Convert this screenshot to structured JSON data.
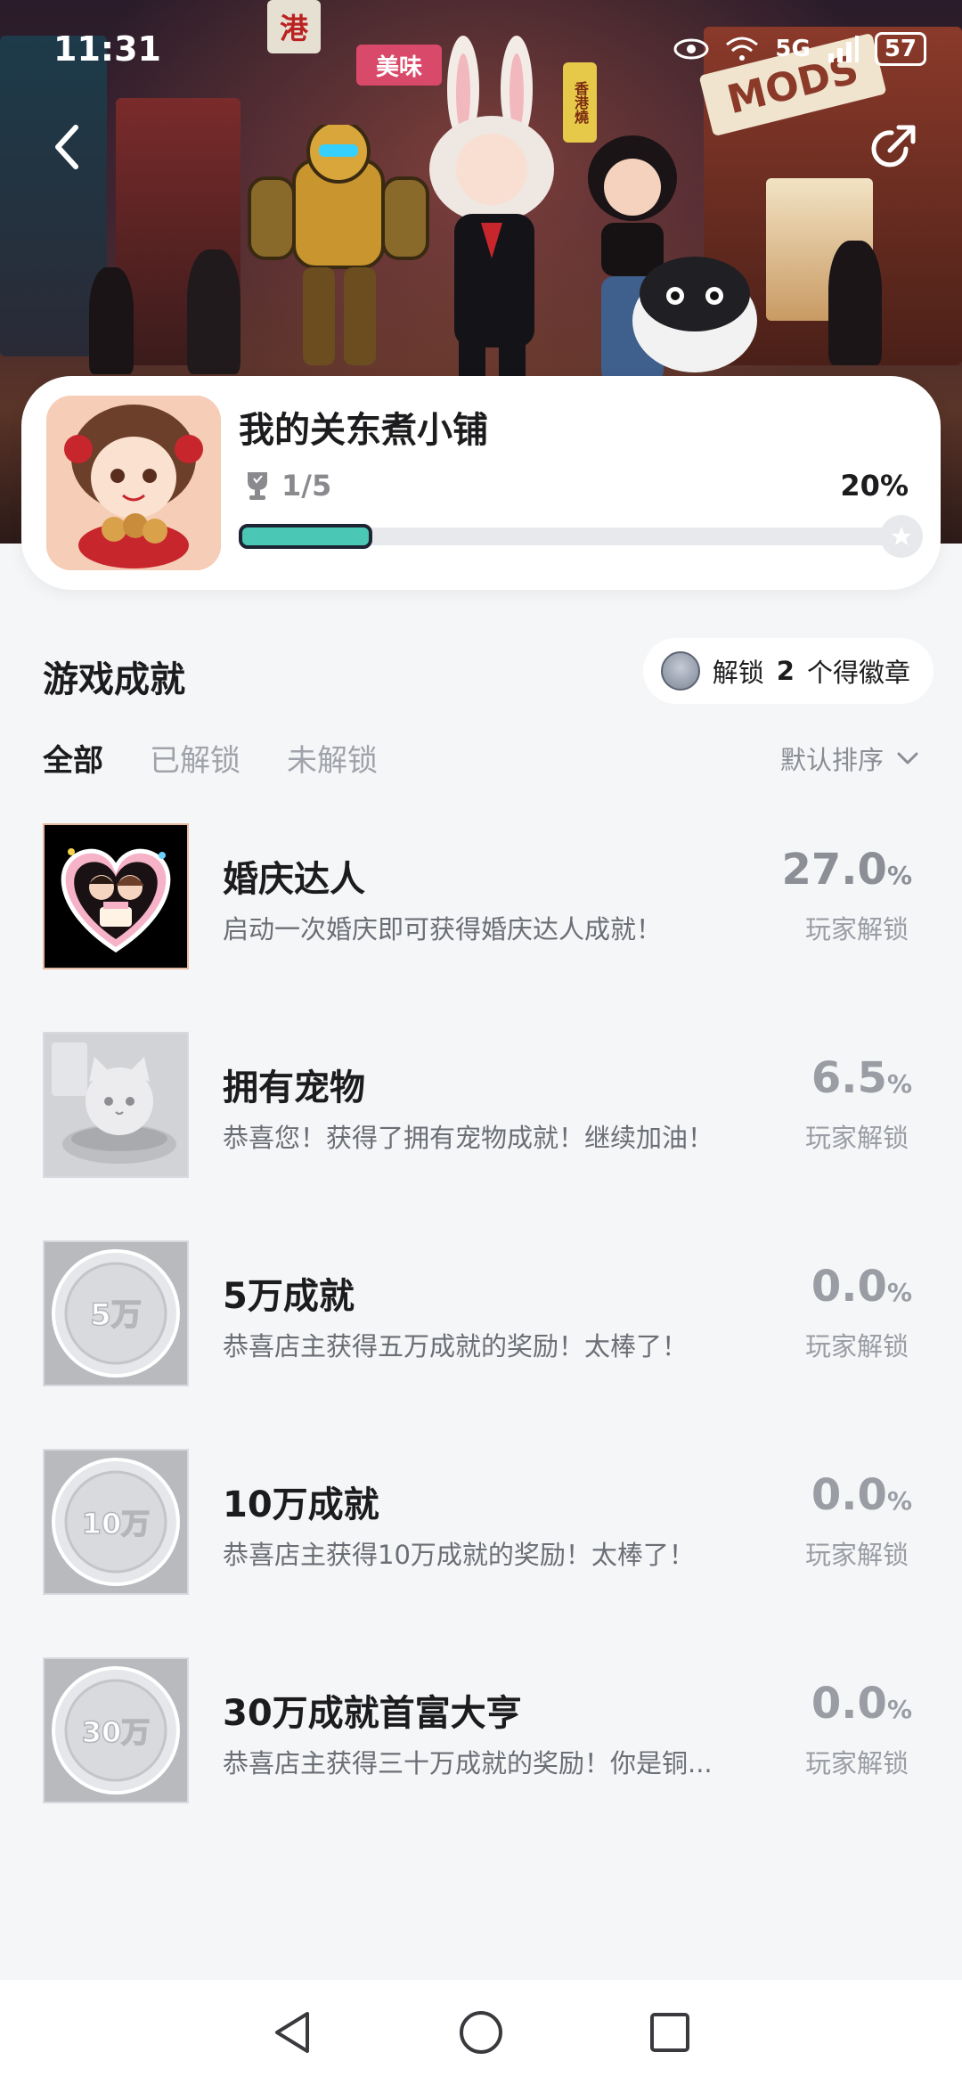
{
  "status": {
    "time": "11:31",
    "network": "5G",
    "battery": "57"
  },
  "header": {
    "back_icon": "chevron-left-icon",
    "share_icon": "share-icon",
    "banner_signs": [
      "港",
      "美味",
      "香港燒",
      "MODS"
    ]
  },
  "shop": {
    "title": "我的关东煮小铺",
    "trophy_icon": "trophy-icon",
    "progress_text": "1/5",
    "progress_percent_text": "20%",
    "progress_fraction": 0.2
  },
  "section": {
    "title": "游戏成就",
    "unlock_pill": {
      "prefix": "解锁",
      "count": "2",
      "suffix": "个得徽章"
    },
    "tabs": [
      {
        "label": "全部",
        "active": true
      },
      {
        "label": "已解锁",
        "active": false
      },
      {
        "label": "未解锁",
        "active": false
      }
    ],
    "sort_label": "默认排序"
  },
  "achievements": [
    {
      "title": "婚庆达人",
      "desc": "启动一次婚庆即可获得婚庆达人成就！",
      "percent": "27.0",
      "unit": "%",
      "sub": "玩家解锁",
      "unlocked": true,
      "icon": "wedding-couple-icon"
    },
    {
      "title": "拥有宠物",
      "desc": "恭喜您！获得了拥有宠物成就！继续加油！",
      "percent": "6.5",
      "unit": "%",
      "sub": "玩家解锁",
      "unlocked": false,
      "icon": "pet-cat-icon"
    },
    {
      "title": "5万成就",
      "desc": "恭喜店主获得五万成就的奖励！太棒了！",
      "percent": "0.0",
      "unit": "%",
      "sub": "玩家解锁",
      "unlocked": false,
      "icon": "coin-5w-icon",
      "coin_text": "5万"
    },
    {
      "title": "10万成就",
      "desc": "恭喜店主获得10万成就的奖励！太棒了！",
      "percent": "0.0",
      "unit": "%",
      "sub": "玩家解锁",
      "unlocked": false,
      "icon": "coin-10w-icon",
      "coin_text": "10万"
    },
    {
      "title": "30万成就首富大亨",
      "desc": "恭喜店主获得三十万成就的奖励！你是铜...",
      "percent": "0.0",
      "unit": "%",
      "sub": "玩家解锁",
      "unlocked": false,
      "icon": "coin-30w-icon",
      "coin_text": "30万"
    }
  ],
  "sysnav": {
    "back": "nav-back-icon",
    "home": "nav-home-icon",
    "recents": "nav-recents-icon"
  }
}
